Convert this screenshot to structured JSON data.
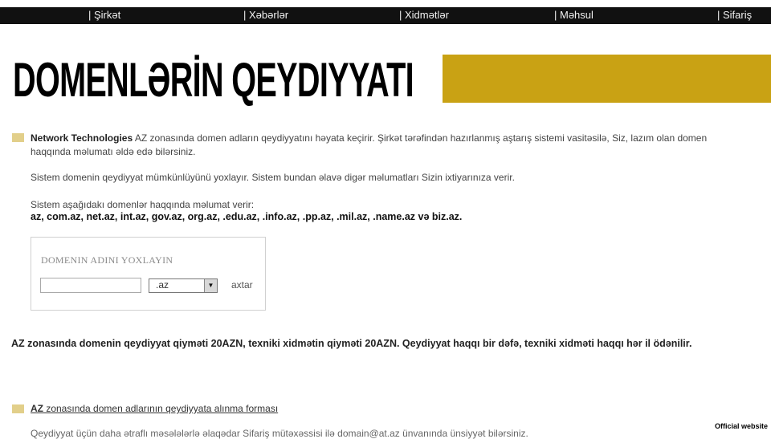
{
  "nav": {
    "items": [
      "| Şirkət",
      "| Xəbərlər",
      "| Xidmətlər",
      "| Məhsul",
      "| Sifariş"
    ]
  },
  "hero": {
    "title": "DOMENLƏRİN QEYDIYYATI"
  },
  "intro": {
    "brand": "Network Technologies",
    "text": " AZ zonasında domen adların qeydiyyatını həyata keçirir. Şirkət tərəfindən hazırlanmış aştarış sistemi vasitəsilə, Siz, lazım olan domen haqqında məlumatı əldə edə bilərsiniz.",
    "para2": "Sistem domenin qeydiyyat mümkünlüyünü yoxlayır. Sistem bundan əlavə digər məlumatları Sizin ixtiyarınıza verir.",
    "para3": "Sistem aşağıdakı domenlər haqqında məlumat verir:",
    "domains": "az, com.az, net.az, int.az, gov.az, org.az, .edu.az, .info.az, .pp.az, .mil.az, .name.az və biz.az."
  },
  "checker": {
    "title": "DOMENIN ADINI YOXLAYIN",
    "input_value": "",
    "zone_selected": ".az",
    "search_label": "axtar"
  },
  "price": {
    "text": "AZ zonasında domenin qeydiyyat qiyməti 20AZN, texniki xidmətin qiyməti 20AZN. Qeydiyyat haqqı bir dəfə, texniki xidməti haqqı hər il ödənilir."
  },
  "form_link": {
    "prefix": "AZ",
    "text": " zonasında domen adlarının qeydiyyata alınma forması"
  },
  "cut_text": "Qeydiyyat üçün daha ətraflı məsələlərlə əlaqədar Sifariş mütəxəssisi ilə domain@at.az ünvanında ünsiyyət bilərsiniz.",
  "watermark": "Official website",
  "colors": {
    "accent": "#c9a214",
    "bullet": "#e2cf8a",
    "topbar": "#111111"
  }
}
